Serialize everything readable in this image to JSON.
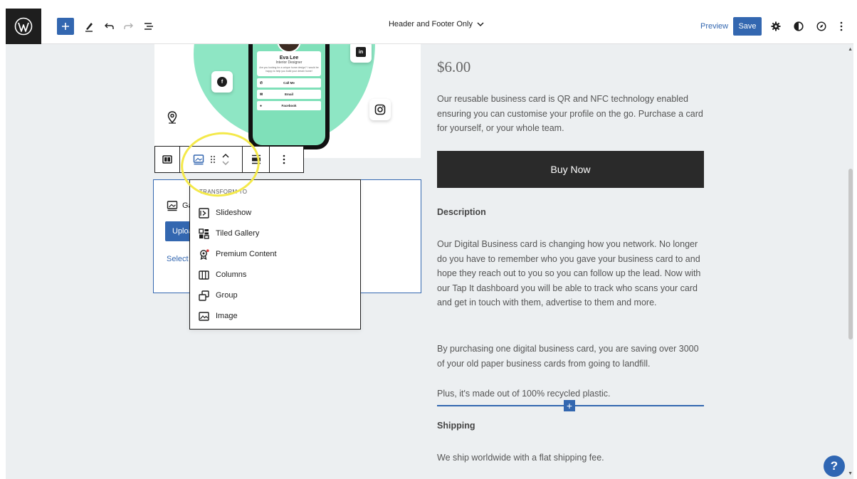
{
  "topbar": {
    "document_title": "Header and Footer Only",
    "preview_label": "Preview",
    "save_label": "Save"
  },
  "product_image": {
    "person_name": "Eva Lee",
    "person_role": "Interior Designer",
    "person_blurb": "Are you looking for a unique home design? I would be happy to help you build your dream home!",
    "actions": [
      "Call Me",
      "Email",
      "Facebook"
    ]
  },
  "gallery_block": {
    "title": "Ga",
    "upload_label": "Uploa",
    "select_label": "Select"
  },
  "transform_menu": {
    "heading": "TRANSFORM TO",
    "items": [
      {
        "label": "Slideshow",
        "icon": "slideshow-icon"
      },
      {
        "label": "Tiled Gallery",
        "icon": "tiled-gallery-icon"
      },
      {
        "label": "Premium Content",
        "icon": "premium-content-icon"
      },
      {
        "label": "Columns",
        "icon": "columns-icon"
      },
      {
        "label": "Group",
        "icon": "group-icon"
      },
      {
        "label": "Image",
        "icon": "image-icon"
      }
    ]
  },
  "product": {
    "price": "$6.00",
    "intro": "Our reusable business card is QR and NFC technology enabled ensuring you can customise your profile on the go. Purchase a card for yourself, or your whole team.",
    "buy_label": "Buy Now",
    "description_heading": "Description",
    "description_p1": "Our Digital Business card is changing how you network. No longer do you have to remember who you gave your business card to and hope they reach out to you so you can follow up the lead. Now with our Tap It dashboard you will be able to track who scans your card and get in touch with them, advertise to them and more.",
    "description_p2": "By purchasing one digital business card, you are saving over 3000 of your old paper business cards from going to landfill.",
    "description_p3": "Plus, it's made out of 100% recycled plastic.",
    "shipping_heading": "Shipping",
    "shipping_text": "We ship worldwide with a flat shipping fee."
  },
  "help": {
    "label": "?"
  },
  "colors": {
    "accent": "#3367b0",
    "canvas_bg": "#eceff1",
    "highlight": "#f4e94a",
    "buy_button": "#2a2a2a"
  }
}
